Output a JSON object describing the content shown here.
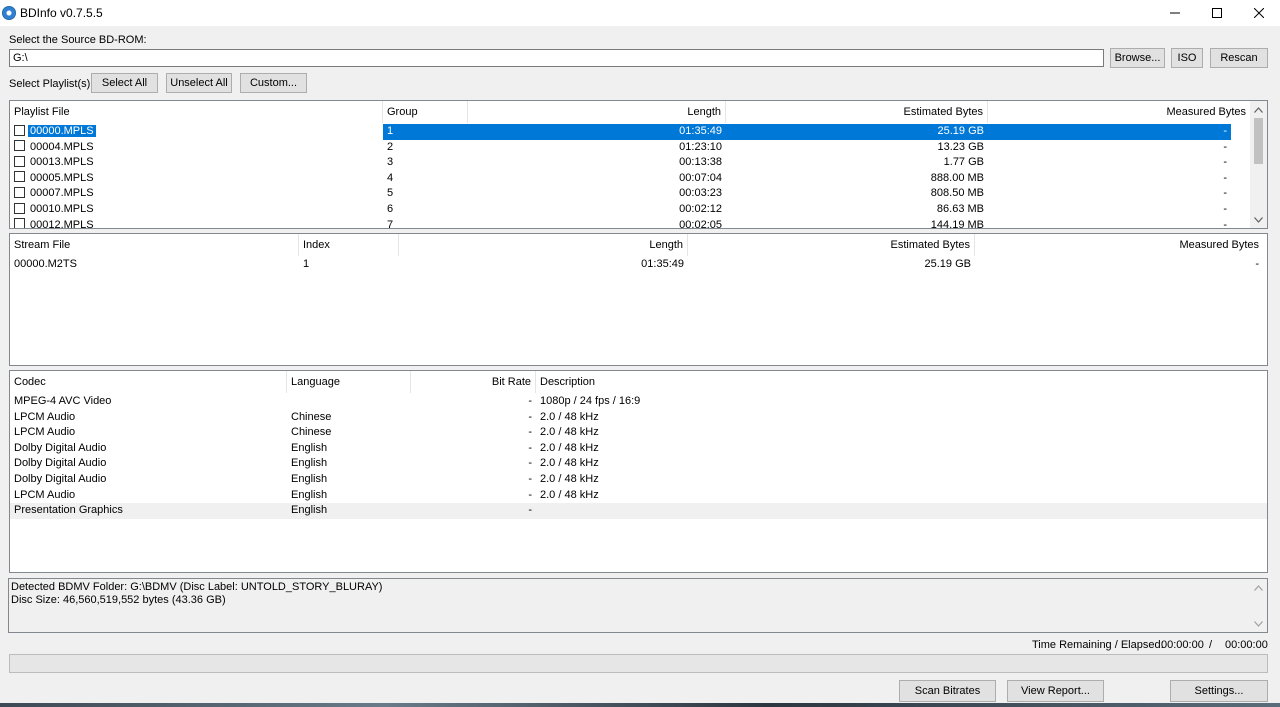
{
  "window": {
    "title": "BDInfo v0.7.5.5"
  },
  "source": {
    "label": "Select the Source BD-ROM:",
    "value": "G:\\",
    "browse_label": "Browse...",
    "iso_label": "ISO",
    "rescan_label": "Rescan"
  },
  "playlist_controls": {
    "label": "Select Playlist(s):",
    "select_all": "Select All",
    "unselect_all": "Unselect All",
    "custom": "Custom..."
  },
  "playlists": {
    "headers": [
      "Playlist File",
      "Group",
      "Length",
      "Estimated Bytes",
      "Measured Bytes"
    ],
    "rows": [
      {
        "file": "00000.MPLS",
        "group": "1",
        "length": "01:35:49",
        "est": "25.19 GB",
        "meas": "-"
      },
      {
        "file": "00004.MPLS",
        "group": "2",
        "length": "01:23:10",
        "est": "13.23 GB",
        "meas": "-"
      },
      {
        "file": "00013.MPLS",
        "group": "3",
        "length": "00:13:38",
        "est": "1.77 GB",
        "meas": "-"
      },
      {
        "file": "00005.MPLS",
        "group": "4",
        "length": "00:07:04",
        "est": "888.00 MB",
        "meas": "-"
      },
      {
        "file": "00007.MPLS",
        "group": "5",
        "length": "00:03:23",
        "est": "808.50 MB",
        "meas": "-"
      },
      {
        "file": "00010.MPLS",
        "group": "6",
        "length": "00:02:12",
        "est": "86.63 MB",
        "meas": "-"
      },
      {
        "file": "00012.MPLS",
        "group": "7",
        "length": "00:02:05",
        "est": "144.19 MB",
        "meas": "-"
      }
    ]
  },
  "streams": {
    "headers": [
      "Stream File",
      "Index",
      "Length",
      "Estimated Bytes",
      "Measured Bytes"
    ],
    "rows": [
      {
        "file": "00000.M2TS",
        "index": "1",
        "length": "01:35:49",
        "est": "25.19 GB",
        "meas": "-"
      }
    ]
  },
  "codecs": {
    "headers": [
      "Codec",
      "Language",
      "Bit Rate",
      "Description"
    ],
    "rows": [
      {
        "codec": "MPEG-4 AVC Video",
        "lang": "",
        "bitrate": "-",
        "desc": "1080p / 24 fps / 16:9"
      },
      {
        "codec": "LPCM Audio",
        "lang": "Chinese",
        "bitrate": "-",
        "desc": "2.0 / 48 kHz"
      },
      {
        "codec": "LPCM Audio",
        "lang": "Chinese",
        "bitrate": "-",
        "desc": "2.0 / 48 kHz"
      },
      {
        "codec": "Dolby Digital Audio",
        "lang": "English",
        "bitrate": "-",
        "desc": "2.0 / 48 kHz"
      },
      {
        "codec": "Dolby Digital Audio",
        "lang": "English",
        "bitrate": "-",
        "desc": "2.0 / 48 kHz"
      },
      {
        "codec": "Dolby Digital Audio",
        "lang": "English",
        "bitrate": "-",
        "desc": "2.0 / 48 kHz"
      },
      {
        "codec": "LPCM Audio",
        "lang": "English",
        "bitrate": "-",
        "desc": "2.0 / 48 kHz"
      },
      {
        "codec": "Presentation Graphics",
        "lang": "English",
        "bitrate": "-",
        "desc": ""
      }
    ]
  },
  "log": {
    "line1": "Detected BDMV Folder: G:\\BDMV (Disc Label: UNTOLD_STORY_BLURAY)",
    "line2": "Disc Size: 46,560,519,552 bytes (43.36 GB)"
  },
  "status": {
    "time_label": "Time Remaining / Elapsed:",
    "remaining": "00:00:00",
    "separator": "/",
    "elapsed": "00:00:00",
    "progress": 0
  },
  "actions": {
    "scan_bitrates": "Scan Bitrates",
    "view_report": "View Report...",
    "settings": "Settings..."
  },
  "colors": {
    "selection": "#0078d7",
    "highlight_row": "#f0f0f0"
  }
}
